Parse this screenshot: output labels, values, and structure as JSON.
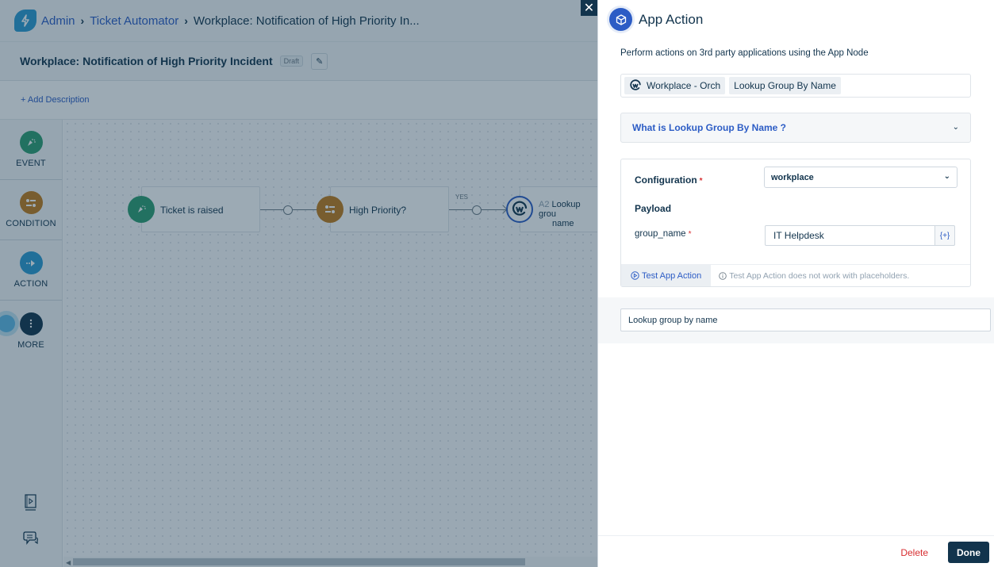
{
  "header": {
    "breadcrumbs": [
      "Admin",
      "Ticket Automator",
      "Workplace: Notification of High Priority In..."
    ],
    "logo_icon": "bolt-icon"
  },
  "workflow": {
    "title": "Workplace: Notification of High Priority Incident",
    "status_badge": "Draft",
    "add_description": "+ Add Description"
  },
  "sidebar": {
    "items": [
      {
        "label": "EVENT",
        "icon": "cursor-click-icon",
        "color": "#2e9e70"
      },
      {
        "label": "CONDITION",
        "icon": "sliders-icon",
        "color": "#c27a1a"
      },
      {
        "label": "ACTION",
        "icon": "arrow-right-icon",
        "color": "#2c9ad1"
      },
      {
        "label": "MORE",
        "icon": "more-vertical-icon",
        "color": "#12344d"
      }
    ],
    "bottom_icons": [
      "video-book-icon",
      "chat-icon"
    ]
  },
  "canvas": {
    "nodes": [
      {
        "label": "Ticket is raised",
        "type": "event",
        "color": "#2e9e70"
      },
      {
        "label": "High Priority?",
        "type": "condition",
        "color": "#c27a1a"
      },
      {
        "prefix": "A2",
        "label": "Lookup group by name",
        "label_visible_line1": "Lookup grou",
        "label_visible_line2": "name",
        "type": "app-action",
        "color": "#2c5cc5"
      }
    ],
    "edge_labels": [
      "YES"
    ]
  },
  "panel": {
    "title": "App Action",
    "subtitle": "Perform actions on 3rd party applications using the App Node",
    "app_chip": "Workplace - Orch",
    "action_chip": "Lookup Group By Name",
    "accordion_label": "What is Lookup Group By Name ?",
    "configuration_label": "Configuration",
    "configuration_value": "workplace",
    "payload_label": "Payload",
    "field_name": "group_name",
    "field_value": "IT Helpdesk",
    "placeholder_button": "{+}",
    "test_button": "Test App Action",
    "test_note": "Test App Action does not work with placeholders.",
    "node_name": "Lookup group by name",
    "delete_label": "Delete",
    "done_label": "Done",
    "close_label": "✕"
  },
  "colors": {
    "primary": "#12344d",
    "link": "#2c5cc5",
    "danger": "#d72d30"
  }
}
